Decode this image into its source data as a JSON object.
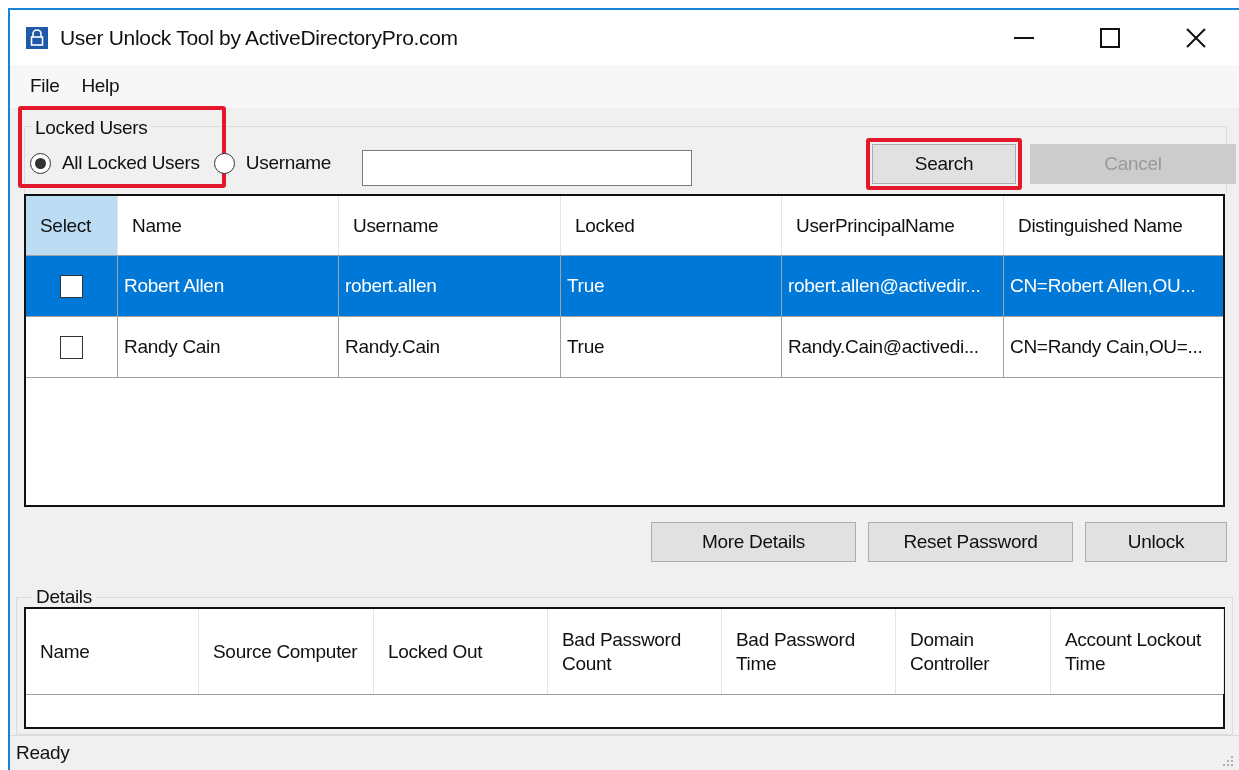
{
  "window": {
    "title": "User Unlock Tool by ActiveDirectoryPro.com"
  },
  "menu": [
    "File",
    "Help"
  ],
  "locked_users": {
    "title": "Locked Users",
    "highlighted": true,
    "options": [
      {
        "label": "All Locked Users",
        "selected": true
      },
      {
        "label": "Username",
        "selected": false
      }
    ]
  },
  "search_buttons": [
    {
      "label": "Search",
      "disabled": false,
      "highlighted": true
    },
    {
      "label": "Cancel",
      "disabled": true,
      "highlighted": false
    }
  ],
  "users_table": {
    "select_column": {
      "label": "Select",
      "selected": true
    },
    "columns": [
      {
        "label": "Name",
        "selected": false
      },
      {
        "label": "Username",
        "selected": false
      },
      {
        "label": "Locked",
        "selected": false
      },
      {
        "label": "UserPrincipalName",
        "selected": false
      },
      {
        "label": "Distinguished Name",
        "selected": false
      }
    ],
    "rows": [
      {
        "selected": true,
        "checked": false,
        "cells": [
          "Robert Allen",
          "robert.allen",
          "True",
          "robert.allen@activedir...",
          "CN=Robert Allen,OU..."
        ]
      },
      {
        "selected": false,
        "checked": false,
        "cells": [
          "Randy Cain",
          "Randy.Cain",
          "True",
          "Randy.Cain@activedi...",
          "CN=Randy Cain,OU=..."
        ]
      }
    ]
  },
  "action_buttons": [
    "More Details",
    "Reset Password",
    "Unlock"
  ],
  "details": {
    "title": "Details",
    "columns": [
      "Name",
      "Source Computer",
      "Locked Out",
      "Bad Password Count",
      "Bad Password Time",
      "Domain Controller",
      "Account Lockout Time"
    ]
  },
  "status_bar": "Ready"
}
